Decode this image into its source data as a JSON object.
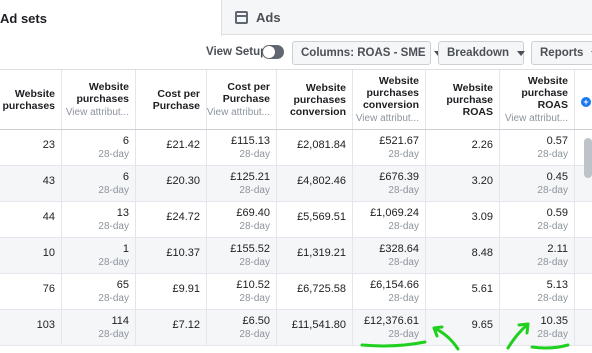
{
  "tabs": [
    {
      "label": "Ad sets",
      "icon": "ad-sets-icon",
      "active": true
    },
    {
      "label": "Ads",
      "icon": "ads-icon",
      "active": false
    }
  ],
  "toolbar": {
    "view_setup_label": "View Setup",
    "view_setup_on": false,
    "columns_label": "Columns: ROAS - SME",
    "breakdown_label": "Breakdown",
    "reports_label": "Reports"
  },
  "table": {
    "headers": [
      {
        "title": "Website purchases",
        "sub": ""
      },
      {
        "title": "Website purchases",
        "sub": "View attribut..."
      },
      {
        "title": "Cost per Purchase",
        "sub": ""
      },
      {
        "title": "Cost per Purchase",
        "sub": "View attribut..."
      },
      {
        "title": "Website purchases conversion",
        "sub": ""
      },
      {
        "title": "Website purchases conversion",
        "sub": "View attribut..."
      },
      {
        "title": "Website purchase ROAS",
        "sub": ""
      },
      {
        "title": "Website purchase ROAS",
        "sub": "View attribut..."
      }
    ],
    "rows": [
      [
        {
          "v": "23"
        },
        {
          "v": "6",
          "s": "28-day"
        },
        {
          "v": "£21.42"
        },
        {
          "v": "£115.13",
          "s": "28-day"
        },
        {
          "v": "£2,081.84"
        },
        {
          "v": "£521.67",
          "s": "28-day"
        },
        {
          "v": "2.26"
        },
        {
          "v": "0.57",
          "s": "28-day"
        }
      ],
      [
        {
          "v": "43"
        },
        {
          "v": "6",
          "s": "28-day"
        },
        {
          "v": "£20.30"
        },
        {
          "v": "£125.21",
          "s": "28-day"
        },
        {
          "v": "£4,802.46"
        },
        {
          "v": "£676.39",
          "s": "28-day"
        },
        {
          "v": "3.20"
        },
        {
          "v": "0.45",
          "s": "28-day"
        }
      ],
      [
        {
          "v": "44"
        },
        {
          "v": "13",
          "s": "28-day"
        },
        {
          "v": "£24.72"
        },
        {
          "v": "£69.40",
          "s": "28-day"
        },
        {
          "v": "£5,569.51"
        },
        {
          "v": "£1,069.24",
          "s": "28-day"
        },
        {
          "v": "3.09"
        },
        {
          "v": "0.59",
          "s": "28-day"
        }
      ],
      [
        {
          "v": "10"
        },
        {
          "v": "1",
          "s": "28-day"
        },
        {
          "v": "£10.37"
        },
        {
          "v": "£155.52",
          "s": "28-day"
        },
        {
          "v": "£1,319.21"
        },
        {
          "v": "£328.64",
          "s": "28-day"
        },
        {
          "v": "8.48"
        },
        {
          "v": "2.11",
          "s": "28-day"
        }
      ],
      [
        {
          "v": "76"
        },
        {
          "v": "65",
          "s": "28-day"
        },
        {
          "v": "£9.91"
        },
        {
          "v": "£10.52",
          "s": "28-day"
        },
        {
          "v": "£6,725.58"
        },
        {
          "v": "£6,154.66",
          "s": "28-day"
        },
        {
          "v": "5.61"
        },
        {
          "v": "5.13",
          "s": "28-day"
        }
      ],
      [
        {
          "v": "103"
        },
        {
          "v": "114",
          "s": "28-day"
        },
        {
          "v": "£7.12"
        },
        {
          "v": "£6.50",
          "s": "28-day"
        },
        {
          "v": "£11,541.80"
        },
        {
          "v": "£12,376.61",
          "s": "28-day"
        },
        {
          "v": "9.65"
        },
        {
          "v": "10.35",
          "s": "28-day"
        }
      ]
    ]
  },
  "colors": {
    "annotation_green": "#1fd01f",
    "accent_blue": "#1877f2"
  }
}
